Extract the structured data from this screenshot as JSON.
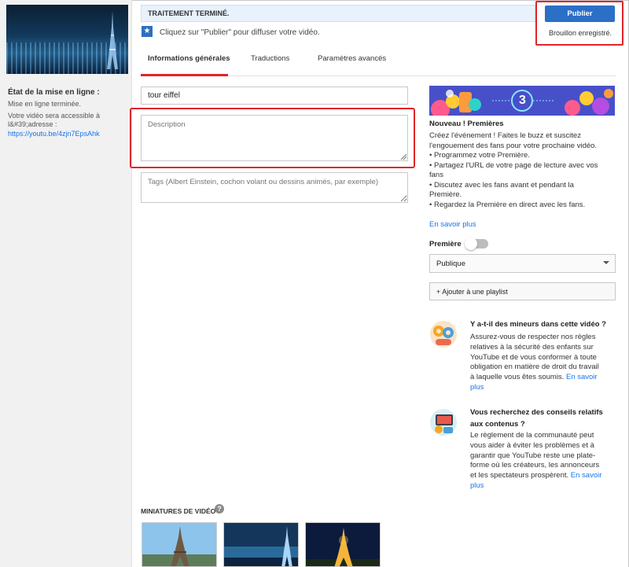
{
  "upload": {
    "title": "État de la mise en ligne :",
    "status": "Mise en ligne terminée.",
    "accessible": "Votre vidéo sera accessible à l&#39;adresse :",
    "link": "https://youtu.be/4zjn7EpsAhk"
  },
  "status_bar": {
    "text": "TRAITEMENT TERMINÉ."
  },
  "hint": {
    "text": "Cliquez sur \"Publier\" pour diffuser votre vidéo."
  },
  "publish": {
    "button": "Publier",
    "draft": "Brouillon enregistré."
  },
  "tabs": [
    {
      "label": "Informations générales",
      "active": true
    },
    {
      "label": "Traductions",
      "active": false
    },
    {
      "label": "Paramètres avancés",
      "active": false
    }
  ],
  "form": {
    "title_value": "tour eiffel",
    "description_placeholder": "Description",
    "tags_placeholder": "Tags (Albert Einstein, cochon volant ou dessins animés, par exemple)"
  },
  "premiere": {
    "banner_number": "3",
    "heading": "Nouveau ! Premières",
    "lines": [
      "Créez l'événement ! Faites le buzz et suscitez",
      "l'engouement des fans pour votre prochaine vidéo.",
      "• Programmez votre Première.",
      "• Partagez l'URL de votre page de lecture avec vos",
      "fans",
      "• Discutez avec les fans avant et pendant la",
      "Première.",
      "• Regardez la Première en direct avec les fans."
    ],
    "link": "En savoir plus",
    "toggle_label": "Première",
    "toggle_on": false
  },
  "visibility": {
    "selected": "Publique"
  },
  "playlist": {
    "label": "+ Ajouter à une playlist"
  },
  "info_minors": {
    "title": "Y a-t-il des mineurs dans cette vidéo ?",
    "lines": [
      "Assurez-vous de respecter nos règles",
      "relatives à la sécurité des enfants sur",
      "YouTube et de vous conformer à toute",
      "obligation en matière de droit du travail"
    ],
    "last_line": "à laquelle vous êtes soumis.",
    "link_part1": "En savoir",
    "link_part2": "plus"
  },
  "info_content": {
    "title_lines": [
      "Vous recherchez des conseils relatifs",
      "aux contenus ?"
    ],
    "lines": [
      "Le règlement de la communauté peut",
      "vous aider à éviter les problèmes et à",
      "garantir que YouTube reste une plate-",
      "forme où les créateurs, les annonceurs"
    ],
    "last_line": "et les spectateurs prospèrent.",
    "link_part1": "En savoir",
    "link_part2": "plus"
  },
  "thumbnails": {
    "title": "MINIATURES DE VIDÉO",
    "help": "?"
  },
  "colors": {
    "accent_red": "#e0242a",
    "primary_blue": "#2b6fc7",
    "link_blue": "#1a73e8"
  }
}
